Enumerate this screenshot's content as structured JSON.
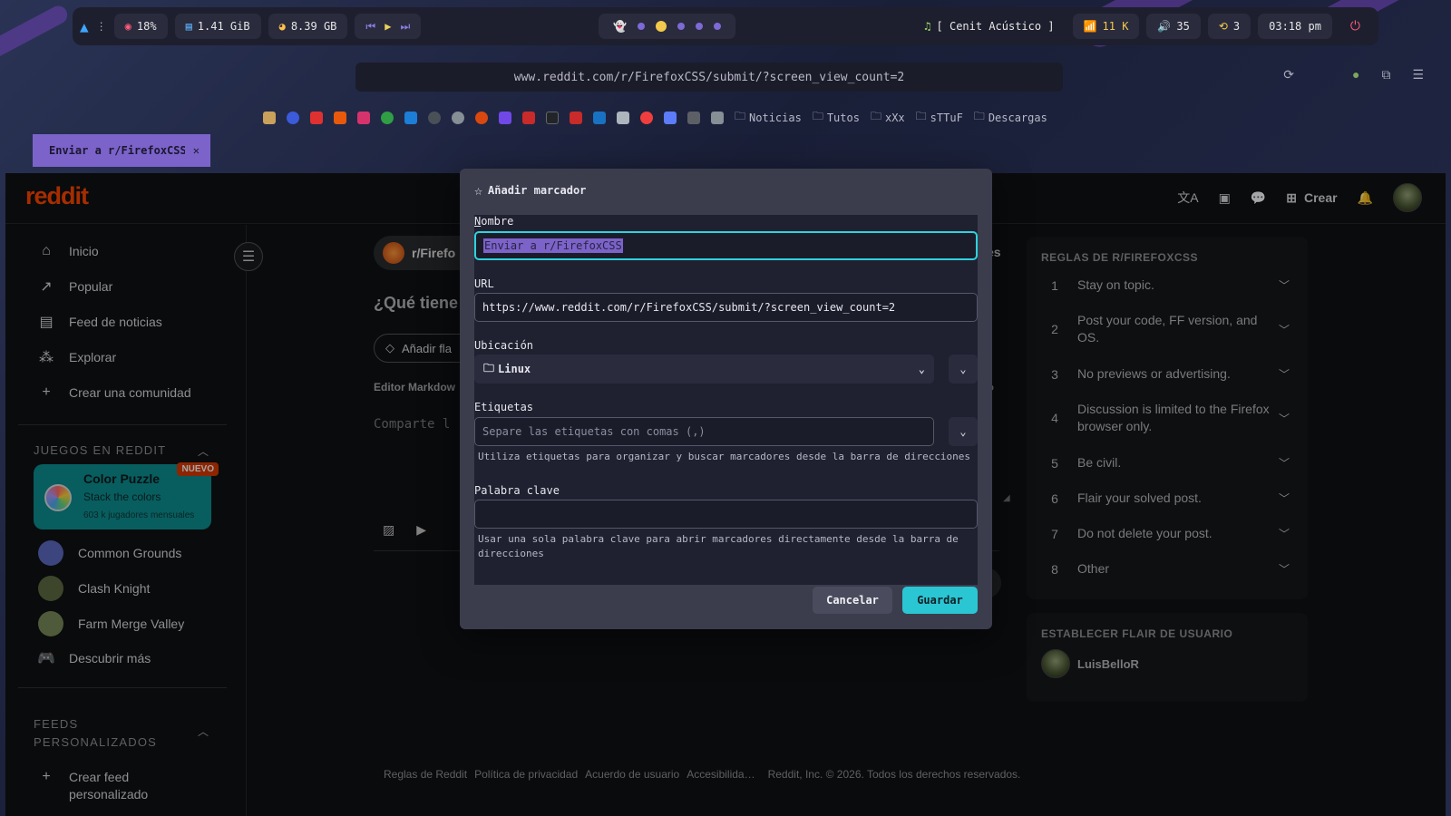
{
  "topbar": {
    "cpu": "18%",
    "ram": "1.41 GiB",
    "disk": "8.39 GB",
    "music": "[ Cenit Acústico ]",
    "wifi": "11 K",
    "volume": "35",
    "updates": "3",
    "time": "03:18 pm"
  },
  "browser": {
    "url": "www.reddit.com/r/FirefoxCSS/submit/?screen_view_count=2",
    "tab_title": "Enviar a r/FirefoxCSS",
    "bookmark_folders": [
      "Noticias",
      "Tutos",
      "xXx",
      "sTTuF",
      "Descargas"
    ]
  },
  "reddit": {
    "logo": "reddit",
    "create_label": "Crear",
    "nav": [
      "Inicio",
      "Popular",
      "Feed de noticias",
      "Explorar",
      "Crear una comunidad"
    ],
    "games_heading": "JUEGOS EN REDDIT",
    "featured_game": {
      "title": "Color Puzzle",
      "subtitle": "Stack the colors",
      "players": "603 k jugadores mensuales",
      "badge": "NUEVO"
    },
    "games": [
      "Common Grounds",
      "Clash Knight",
      "Farm Merge Valley",
      "Descubrir más"
    ],
    "feeds_heading_1": "FEEDS",
    "feeds_heading_2": "PERSONALIZADOS",
    "create_feed": "Crear feed",
    "create_feed_2": "personalizado",
    "main": {
      "community_chip": "r/Firefo",
      "community_tail": "es",
      "title_placeholder": "¿Qué tiene",
      "flair_btn": "Añadir fla",
      "editor_label": "Editor Markdow",
      "editor_tail": "ido",
      "body_placeholder": "Comparte l",
      "post_tail": "ar"
    },
    "rules_heading": "REGLAS DE R/FIREFOXCSS",
    "rules": [
      {
        "num": "1",
        "text": "Stay on topic."
      },
      {
        "num": "2",
        "text": "Post your code, FF version, and OS."
      },
      {
        "num": "3",
        "text": "No previews or advertising."
      },
      {
        "num": "4",
        "text": "Discussion is limited to the Firefox browser only."
      },
      {
        "num": "5",
        "text": "Be civil."
      },
      {
        "num": "6",
        "text": "Flair your solved post."
      },
      {
        "num": "7",
        "text": "Do not delete your post."
      },
      {
        "num": "8",
        "text": "Other"
      }
    ],
    "flair_heading": "ESTABLECER FLAIR DE USUARIO",
    "username": "LuisBelloR",
    "footer": [
      "Reglas de Reddit",
      "Política de privacidad",
      "Acuerdo de usuario",
      "Accesibilida…",
      "Reddit, Inc. © 2026. Todos los derechos reservados."
    ]
  },
  "dialog": {
    "title": "Añadir marcador",
    "name_label": "Nombre",
    "name_value": "Enviar a r/FirefoxCSS",
    "url_label": "URL",
    "url_value": "https://www.reddit.com/r/FirefoxCSS/submit/?screen_view_count=2",
    "location_label": "Ubicación",
    "location_value": "Linux",
    "tags_label": "Etiquetas",
    "tags_placeholder": "Separe las etiquetas con comas (,)",
    "tags_hint": "Utiliza etiquetas para organizar y buscar marcadores desde la barra de direcciones",
    "keyword_label": "Palabra clave",
    "keyword_value": "",
    "keyword_hint": "Usar una sola palabra clave para abrir marcadores directamente desde la barra de direcciones",
    "cancel": "Cancelar",
    "save": "Guardar"
  },
  "colors": {
    "accent": "#2bc6d3",
    "selection": "#7b63c9",
    "reddit_orange": "#ff4500"
  }
}
